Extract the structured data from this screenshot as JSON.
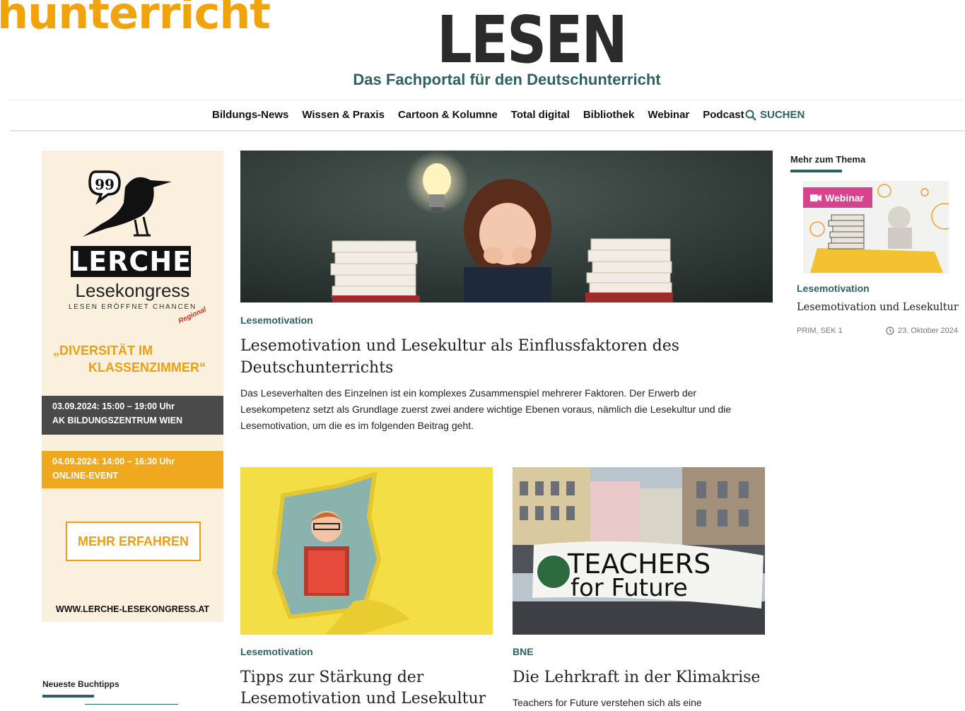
{
  "header": {
    "cropped_brand": "hunterricht",
    "logo": "LESEN",
    "tagline": "Das Fachportal für den Deutschunterricht"
  },
  "nav": {
    "items": [
      "Bildungs-News",
      "Wissen & Praxis",
      "Cartoon & Kolumne",
      "Total digital",
      "Bibliothek",
      "Webinar",
      "Podcast"
    ],
    "search_label": "SUCHEN",
    "search_icon": "search-icon"
  },
  "ad": {
    "brand": "LERCHE",
    "subtitle": "Lesekongress",
    "claim": "LESEN ERÖFFNET CHANCEN",
    "regional": "Regional",
    "theme_line1": "„DIVERSITÄT IM",
    "theme_line2": "KLASSENZIMMER“",
    "event1_time": "03.09.2024: 15:00 – 19:00 Uhr",
    "event1_place": "AK BILDUNGSZENTRUM WIEN",
    "event2_time": "04.09.2024: 14:00 – 16:30 Uhr",
    "event2_place": "ONLINE-EVENT",
    "button": "MEHR ERFAHREN",
    "url": "WWW.LERCHE-LESEKONGRESS.AT",
    "colors": {
      "orange": "#f0a91e",
      "dark": "#4a4a4a",
      "background": "#fbf0dd"
    }
  },
  "left_section": {
    "heading": "Neueste Buchtipps"
  },
  "featured": {
    "category": "Lesemotivation",
    "title_line1": "Lesemotivation und Lesekultur als Einflussfaktoren des",
    "title_line2": "Deutschunterrichts",
    "teaser_line1": "Das Leseverhalten des Einzelnen ist ein komplexes Zusammenspiel mehrerer Faktoren. Der Erwerb der",
    "teaser_line2": "Lesekompetenz setzt als Grundlage zuerst zwei andere wichtige Ebenen voraus, nämlich die Lesekultur und die",
    "teaser_line3": "Lesemotivation, um die es im folgenden Beitrag geht."
  },
  "article2": {
    "category": "Lesemotivation",
    "title_line1": "Tipps zur Stärkung der",
    "title_line2": "Lesemotivation und Lesekultur"
  },
  "article3": {
    "category": "BNE",
    "title": "Die Lehrkraft in der Klimakrise",
    "teaser": "Teachers for Future verstehen sich als eine",
    "banner_line1": "TEACHERS",
    "banner_line2": "for Future"
  },
  "sidebar": {
    "heading": "Mehr zum Thema",
    "badge": "Webinar",
    "category": "Lesemotivation",
    "title": "Lesemotivation und Lesekultur",
    "tags": "PRIM, SEK 1",
    "date": "23. Oktober 2024"
  },
  "theme": {
    "teal": "#2f6163",
    "orange": "#f0a30a",
    "pink": "#d6448e"
  }
}
